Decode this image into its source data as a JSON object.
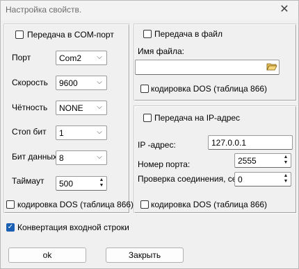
{
  "window": {
    "title": "Настройка свойств.",
    "close_glyph": "✕"
  },
  "com": {
    "enable_label": "Передача в COM-порт",
    "port_label": "Порт",
    "port_value": "Com2",
    "speed_label": "Скорость",
    "speed_value": "9600",
    "parity_label": "Чётность",
    "parity_value": "NONE",
    "stopbits_label": "Стоп бит",
    "stopbits_value": "1",
    "databits_label": "Бит данных",
    "databits_value": "8",
    "timeout_label": "Таймаут",
    "timeout_value": "500",
    "dos_label": "кодировка DOS (таблица 866)"
  },
  "file": {
    "enable_label": "Передача в файл",
    "filename_label": "Имя файла:",
    "filename_value": "",
    "dos_label": "кодировка DOS (таблица 866)"
  },
  "ip": {
    "enable_label": "Передача на IP-адрес",
    "address_label": "IP -адрес:",
    "address_value": "127.0.0.1",
    "port_label": "Номер порта:",
    "port_value": "2555",
    "check_label": "Проверка соединения, сек",
    "check_value": "0",
    "dos_label": "кодировка DOS (таблица 866)"
  },
  "convert_label": "Конвертация входной строки",
  "buttons": {
    "ok": "ok",
    "close": "Закрыть"
  }
}
